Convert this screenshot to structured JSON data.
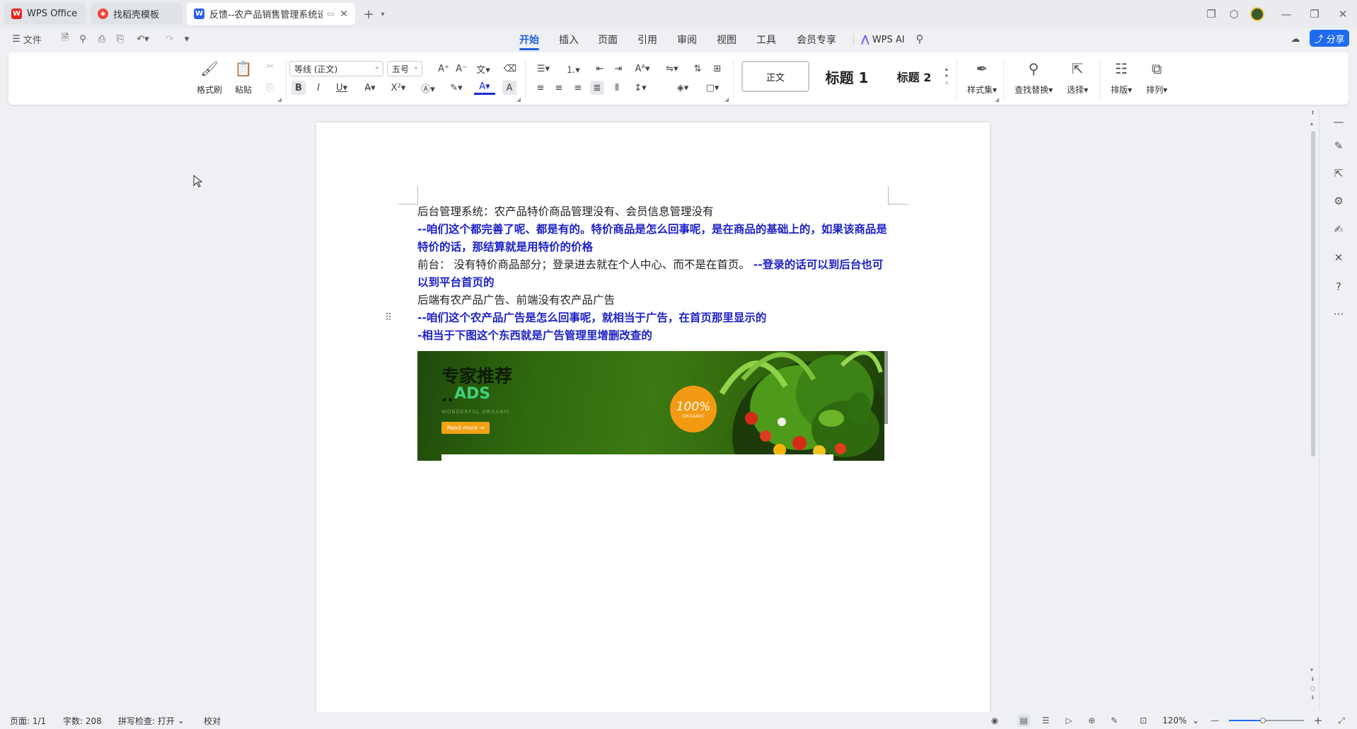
{
  "tabs": [
    {
      "label": "WPS Office",
      "icon": "wps-logo-icon",
      "color": "#e0281f"
    },
    {
      "label": "找稻壳模板",
      "icon": "docer-icon",
      "color": "#e8463c"
    },
    {
      "label": "反馈--农产品销售管理系统设计",
      "icon": "word-doc-icon",
      "color": "#2a5ff0"
    }
  ],
  "new_tab_label": "+",
  "file_menu_label": "文件",
  "menu_tabs": [
    "开始",
    "插入",
    "页面",
    "引用",
    "审阅",
    "视图",
    "工具",
    "会员专享"
  ],
  "wps_ai_label": "WPS AI",
  "share_label": "分享",
  "ribbon": {
    "format_painter": "格式刷",
    "paste": "粘贴",
    "font_name": "等线 (正文)",
    "font_size": "五号",
    "bold": "B",
    "italic": "I",
    "underline": "U",
    "styles": [
      "正文",
      "标题 1",
      "标题 2"
    ],
    "style_gallery": "样式集",
    "find_replace": "查找替换",
    "select": "选择",
    "layout": "排版",
    "arrange": "排列"
  },
  "document": {
    "lines": [
      {
        "text": "后台管理系统：农产品特价商品管理没有、会员信息管理没有",
        "style": "normal"
      },
      {
        "text": "--咱们这个都完善了呢、都是有的。特价商品是怎么回事呢，是在商品的基础上的，如果该商品是特价的话，那结算就是用特价的价格",
        "style": "blue"
      },
      {
        "text_normal": "前台：  没有特价商品部分；登录进去就在个人中心、而不是在首页。 ",
        "text_blue": "--登录的话可以到后台也可以到平台首页的"
      },
      {
        "text": "后端有农产品广告、前端没有农产品广告",
        "style": "normal"
      },
      {
        "text": "--咱们这个农产品广告是怎么回事呢，就相当于广告，在首页那里显示的",
        "style": "blue"
      },
      {
        "text": "-相当于下图这个东西就是广告管理里增删改查的",
        "style": "blue"
      }
    ],
    "image": {
      "title": "专家推荐",
      "subtitle_prefix": "..",
      "subtitle": "ADS",
      "tagline": "WONDERFUL ORGANIC",
      "button": "Read more →",
      "badge_big": "100%",
      "badge_small": "ORGANIC"
    }
  },
  "statusbar": {
    "page": "页面: 1/1",
    "words": "字数: 208",
    "spell": "拼写检查: 打开",
    "proof": "校对",
    "zoom": "120%"
  },
  "colors": {
    "accent": "#1f5fe0",
    "blue_text": "#1e22c8",
    "share_btn": "#1f6bf0"
  },
  "zoom_slider_fraction": 0.45
}
